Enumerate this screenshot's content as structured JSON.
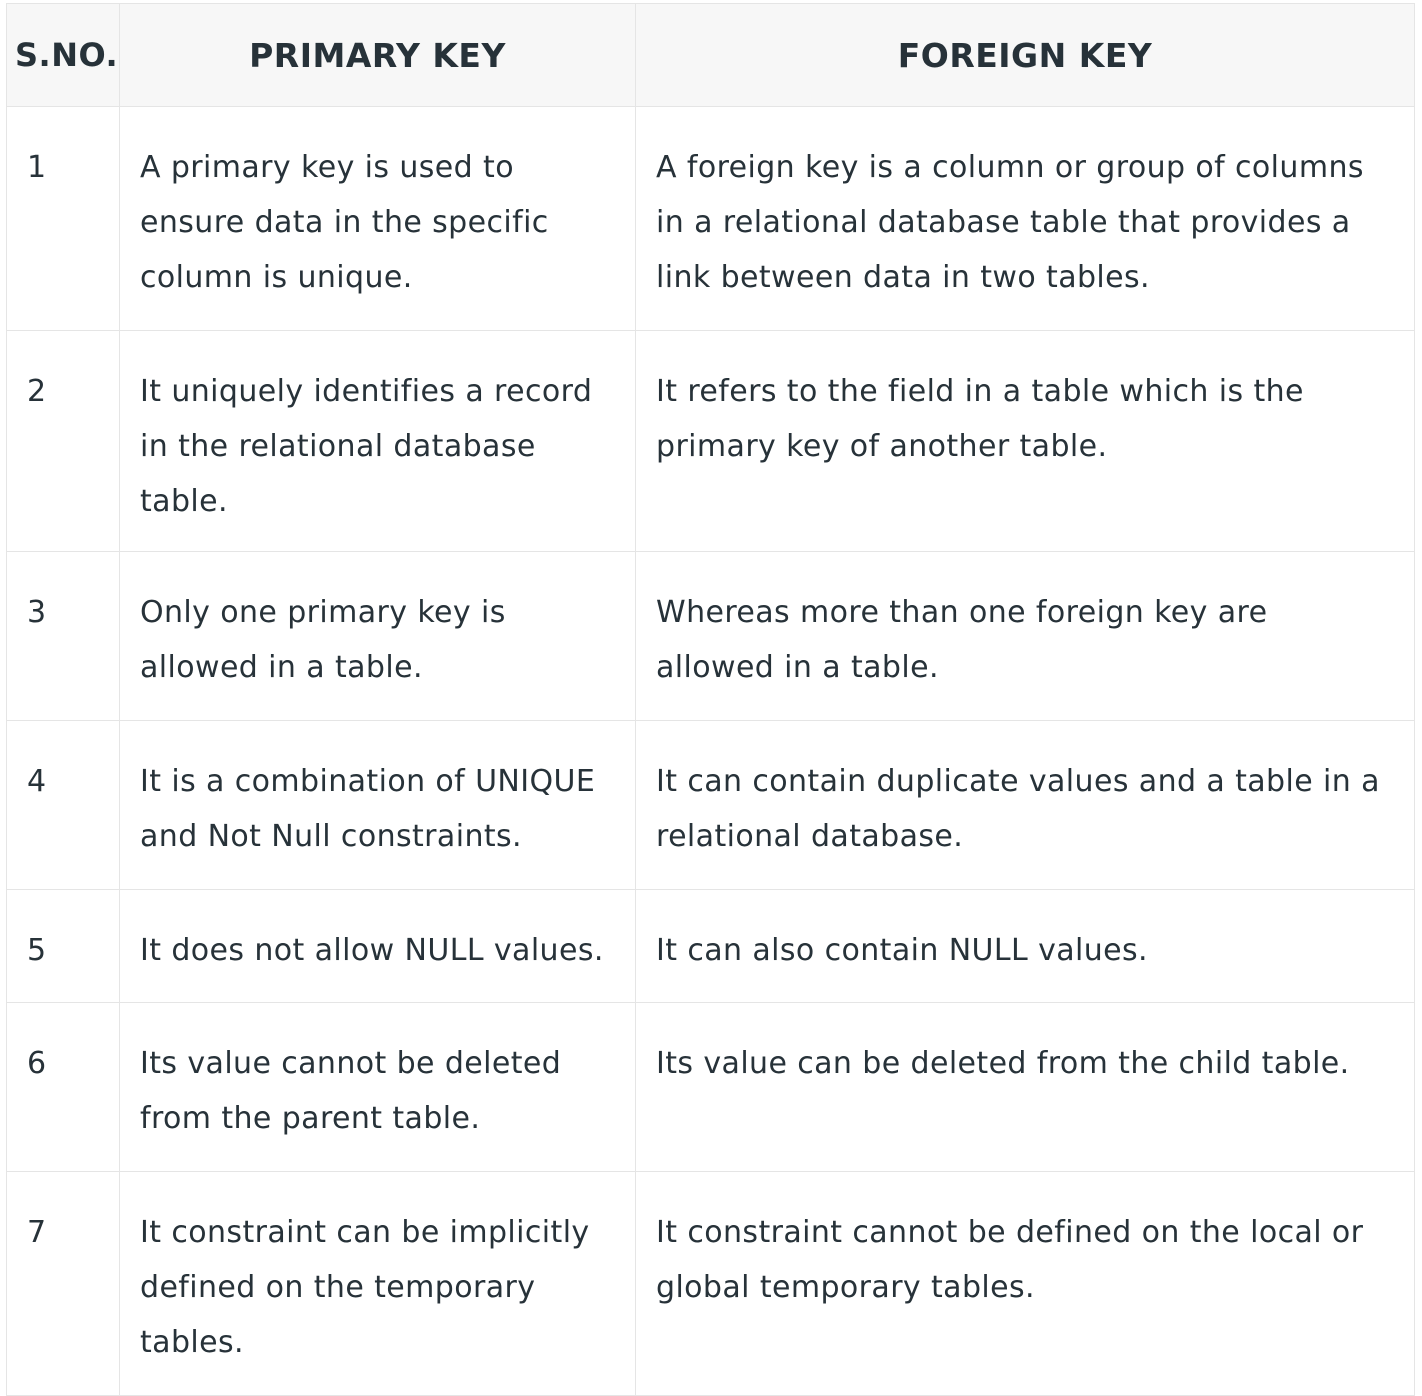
{
  "table": {
    "headers": {
      "sno": "S.NO.",
      "primary": "PRIMARY KEY",
      "foreign": "FOREIGN KEY"
    },
    "rows": [
      {
        "sno": "1",
        "primary": "A primary key is used to ensure data in the specific column is unique.",
        "foreign": "A foreign key is a column or group of columns in a relational database table that provides a link between data in two tables."
      },
      {
        "sno": "2",
        "primary": "It uniquely identifies a record in the relational database table.",
        "foreign": "It refers to the field in a table which is the primary key of another table."
      },
      {
        "sno": "3",
        "primary": "Only one primary key is allowed in a table.",
        "foreign": "Whereas more than one foreign key are allowed in a table."
      },
      {
        "sno": "4",
        "primary": "It is a combination of UNIQUE and Not Null constraints.",
        "foreign": "It can contain duplicate values and a table in a relational database."
      },
      {
        "sno": "5",
        "primary": "It does not allow NULL values.",
        "foreign": "It can also contain NULL values."
      },
      {
        "sno": "6",
        "primary": "Its value cannot be deleted from the parent table.",
        "foreign": "Its value can be deleted from the child table."
      },
      {
        "sno": "7",
        "primary": "It constraint can be implicitly defined on the temporary tables.",
        "foreign": "It constraint cannot be defined on the local or global temporary tables."
      }
    ]
  }
}
